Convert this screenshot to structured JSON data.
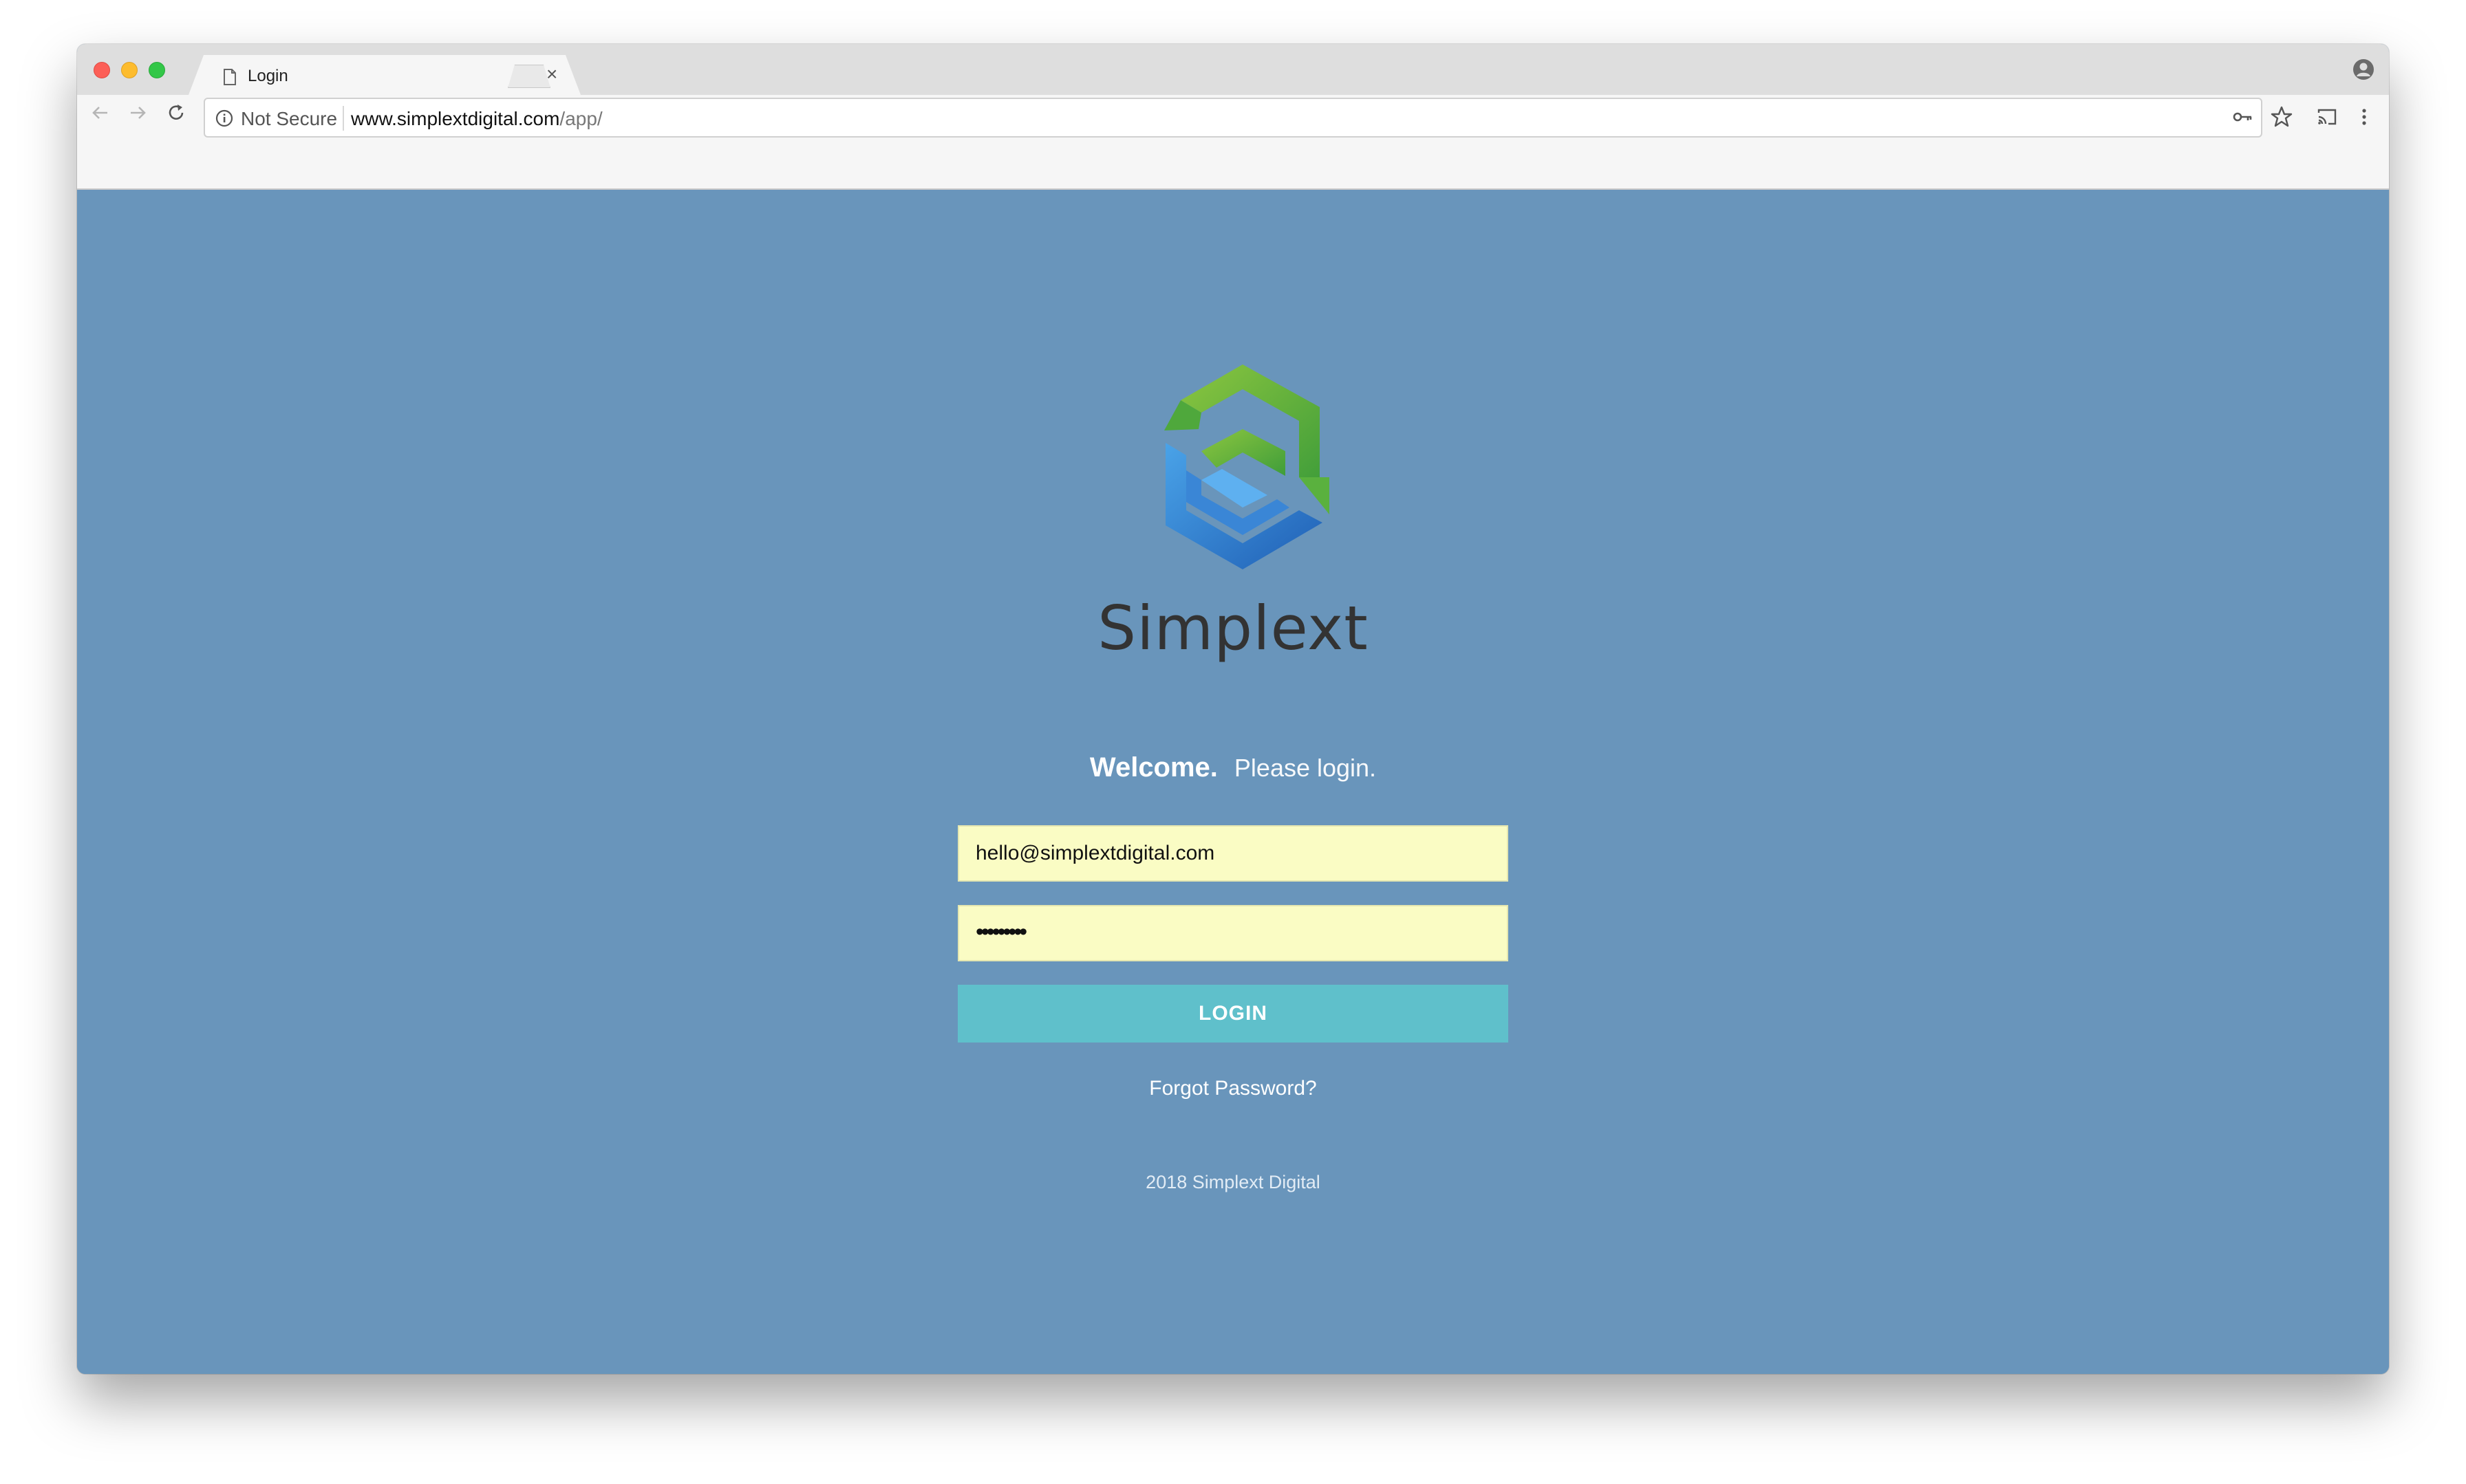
{
  "browser": {
    "tab": {
      "title": "Login",
      "close_glyph": "×"
    },
    "address": {
      "security_label": "Not Secure",
      "url_host": "www.simplextdigital.com",
      "url_path": "/app/"
    },
    "icons": [
      "back-arrow-icon",
      "forward-arrow-icon",
      "reload-icon",
      "info-icon",
      "key-icon",
      "star-icon",
      "cast-icon",
      "menu-icon",
      "profile-icon",
      "page-icon"
    ]
  },
  "login": {
    "brand_name": "Simplext",
    "welcome": "Welcome.",
    "subtitle": "Please login.",
    "email_value": "hello@simplextdigital.com",
    "password_mask": "•••••••••",
    "login_label": "LOGIN",
    "forgot_label": "Forgot Password?",
    "footer": "2018 Simplext Digital"
  },
  "colors": {
    "background": "#6995bb",
    "input_fill": "#fafcc4",
    "button": "#5fc0cb",
    "logo_green": "#5ab13e",
    "logo_blue": "#2f7fd0"
  }
}
